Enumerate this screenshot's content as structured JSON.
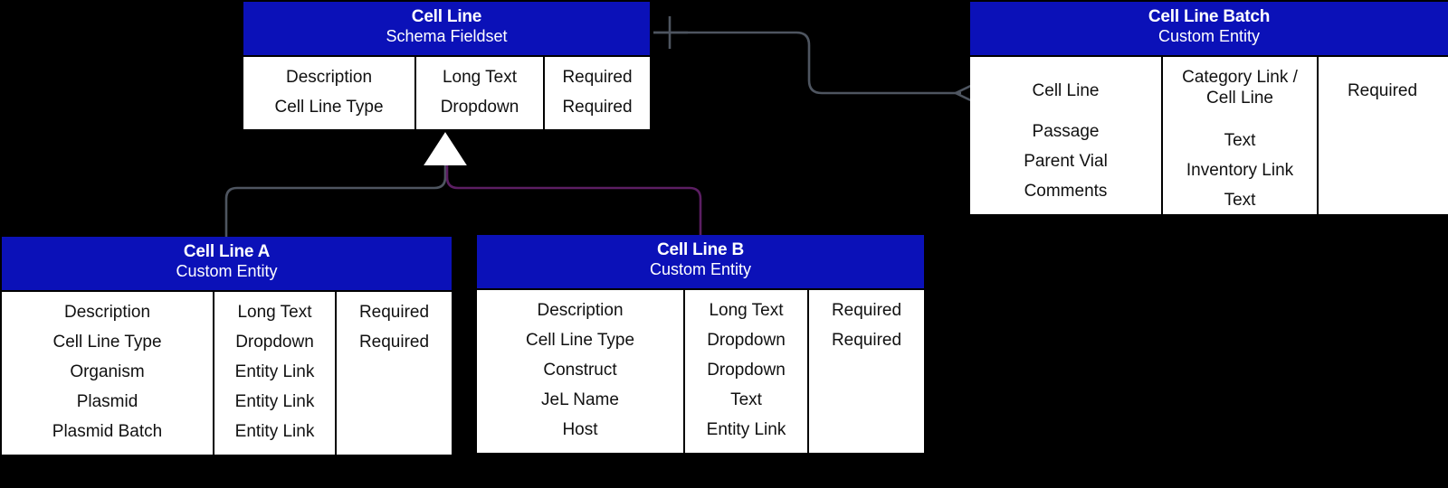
{
  "diagram": {
    "kind": "schema-entity-relationship-diagram",
    "accent_blue": "#0B11B8",
    "background": "#000000",
    "wire_gray": "#4E5560",
    "wire_purple": "#5C1E63"
  },
  "entities": {
    "cell_line": {
      "title": "Cell Line",
      "subtitle": "Schema Fieldset",
      "columns": [
        {
          "name": "field-name-column",
          "cells": [
            "Description",
            "Cell Line Type"
          ]
        },
        {
          "name": "field-type-column",
          "cells": [
            "Long Text",
            "Dropdown"
          ]
        },
        {
          "name": "field-constraint-column",
          "cells": [
            "Required",
            "Required"
          ]
        }
      ]
    },
    "cell_line_batch": {
      "title": "Cell Line Batch",
      "subtitle": "Custom Entity",
      "columns": [
        {
          "name": "field-name-column",
          "cells": [
            "Cell Line",
            "",
            "Passage",
            "Parent Vial",
            "Comments"
          ]
        },
        {
          "name": "field-type-column",
          "cells": [
            "Category Link / Cell Line",
            "Text",
            "Inventory Link",
            "Text"
          ]
        },
        {
          "name": "field-constraint-column",
          "cells": [
            "Required"
          ]
        }
      ]
    },
    "cell_line_a": {
      "title": "Cell Line A",
      "subtitle": "Custom Entity",
      "columns": [
        {
          "name": "field-name-column",
          "cells": [
            "Description",
            "Cell Line Type",
            "Organism",
            "Plasmid",
            "Plasmid Batch"
          ]
        },
        {
          "name": "field-type-column",
          "cells": [
            "Long Text",
            "Dropdown",
            "Entity Link",
            "Entity Link",
            "Entity Link"
          ]
        },
        {
          "name": "field-constraint-column",
          "cells": [
            "Required",
            "Required"
          ]
        }
      ]
    },
    "cell_line_b": {
      "title": "Cell Line B",
      "subtitle": "Custom Entity",
      "columns": [
        {
          "name": "field-name-column",
          "cells": [
            "Description",
            "Cell Line Type",
            "Construct",
            "JeL Name",
            "Host"
          ]
        },
        {
          "name": "field-type-column",
          "cells": [
            "Long Text",
            "Dropdown",
            "Dropdown",
            "Text",
            "Entity Link"
          ]
        },
        {
          "name": "field-constraint-column",
          "cells": [
            "Required",
            "Required"
          ]
        }
      ]
    }
  },
  "connectors": [
    {
      "name": "cell-line-to-cell-line-batch",
      "from": "cell_line",
      "to": "cell_line_batch",
      "source_marker": "plus-cross",
      "target_marker": "open-arrow",
      "color": "#4E5560"
    },
    {
      "name": "cell-line-a-inherits-cell-line",
      "from": "cell_line_a",
      "to": "cell_line",
      "target_marker": "hollow-triangle",
      "color": "#4E5560"
    },
    {
      "name": "cell-line-b-inherits-cell-line",
      "from": "cell_line_b",
      "to": "cell_line",
      "target_marker": "hollow-triangle",
      "color": "#5C1E63"
    }
  ]
}
